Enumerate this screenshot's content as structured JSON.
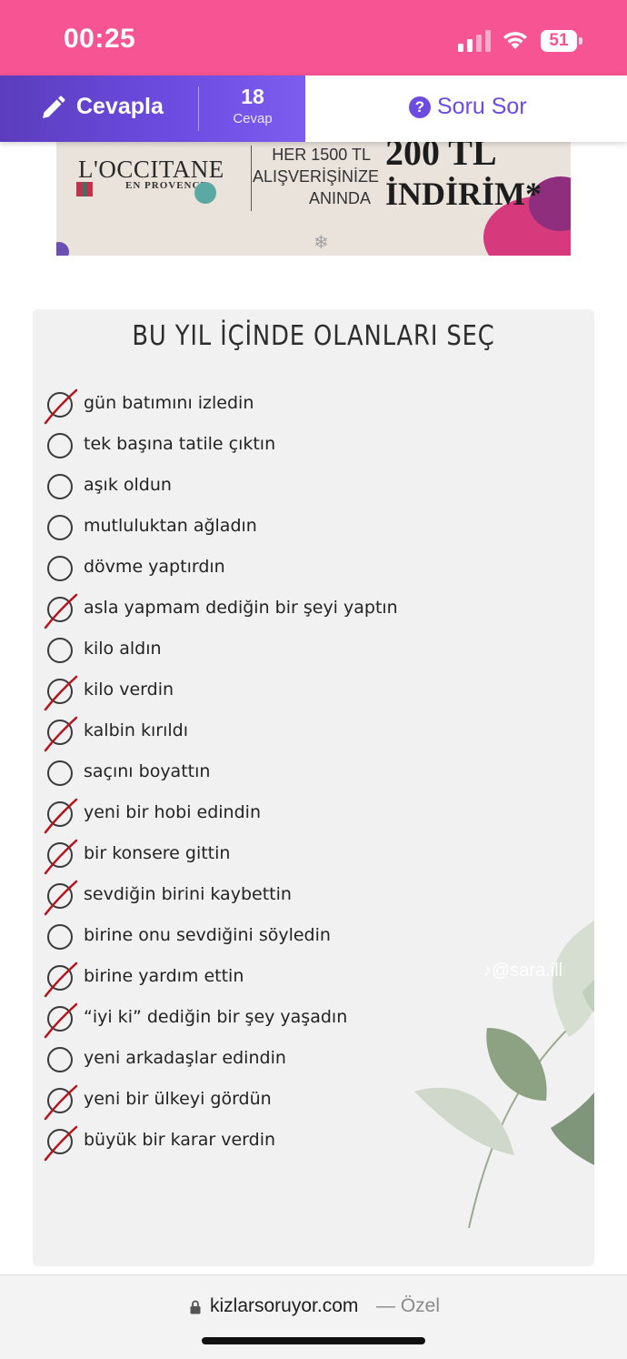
{
  "status_bar": {
    "time": "00:25",
    "battery": "51"
  },
  "action_bar": {
    "answer_label": "Cevapla",
    "answer_count": "18",
    "answer_count_label": "Cevap",
    "ask_label": "Soru Sor"
  },
  "ad": {
    "brand": "L'OCCITANE",
    "brand_sub": "EN PROVENCE",
    "line1": "HER 1500 TL",
    "line2": "ALIŞVERİŞİNİZE",
    "line3": "ANINDA",
    "big1": "200 TL",
    "big2": "İNDİRİM*"
  },
  "card": {
    "title": "BU YIL İÇİNDE OLANLARI SEÇ",
    "watermark": "♪@sara.ill",
    "items": [
      {
        "label": "gün batımını izledin",
        "checked": true
      },
      {
        "label": "tek başına tatile çıktın",
        "checked": false
      },
      {
        "label": "aşık oldun",
        "checked": false
      },
      {
        "label": "mutluluktan ağladın",
        "checked": false
      },
      {
        "label": "dövme yaptırdın",
        "checked": false
      },
      {
        "label": "asla yapmam dediğin bir şeyi yaptın",
        "checked": true
      },
      {
        "label": "kilo aldın",
        "checked": false
      },
      {
        "label": "kilo verdin",
        "checked": true
      },
      {
        "label": "kalbin kırıldı",
        "checked": true
      },
      {
        "label": "saçını boyattın",
        "checked": false
      },
      {
        "label": "yeni bir hobi edindin",
        "checked": true
      },
      {
        "label": "bir konsere gittin",
        "checked": true
      },
      {
        "label": "sevdiğin birini kaybettin",
        "checked": true
      },
      {
        "label": "birine onu sevdiğini söyledin",
        "checked": false
      },
      {
        "label": "birine yardım ettin",
        "checked": true
      },
      {
        "label": "“iyi ki” dediğin bir şey yaşadın",
        "checked": true
      },
      {
        "label": "yeni arkadaşlar edindin",
        "checked": false
      },
      {
        "label": "yeni bir ülkeyi gördün",
        "checked": true
      },
      {
        "label": "büyük bir karar verdin",
        "checked": true
      }
    ]
  },
  "url_bar": {
    "url": "kizlarsoruyor.com",
    "private_label": "— Özel"
  },
  "colors": {
    "status_pink": "#f65493",
    "accent_purple": "#6c4be0",
    "check_red": "#b5121b"
  }
}
